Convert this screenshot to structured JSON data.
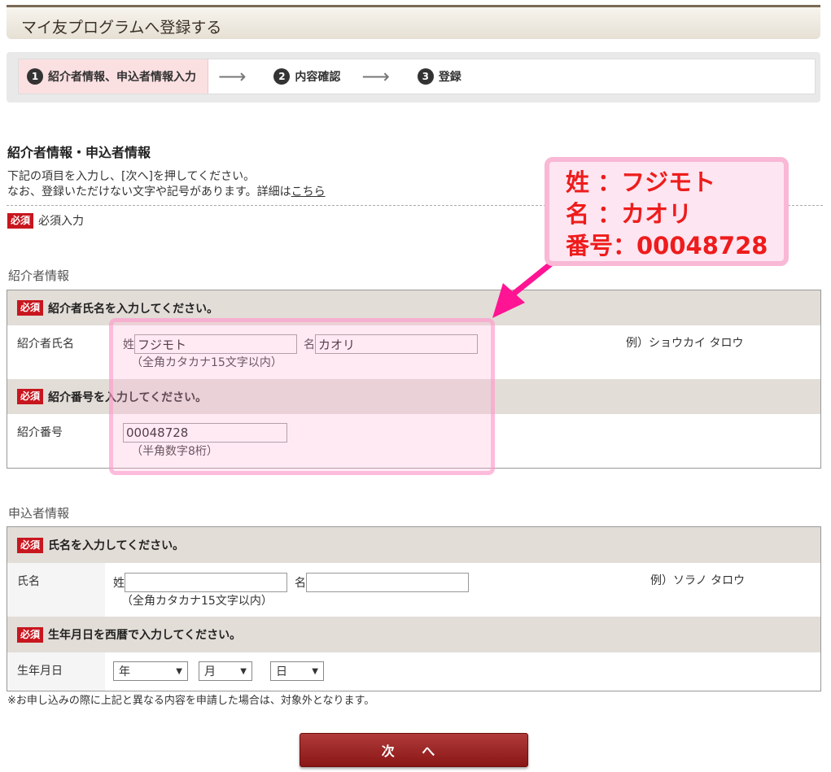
{
  "page": {
    "title": "マイ友プログラムへ登録する"
  },
  "steps": [
    {
      "num": "1",
      "label": "紹介者情報、申込者情報入力",
      "active": true
    },
    {
      "num": "2",
      "label": "内容確認",
      "active": false
    },
    {
      "num": "3",
      "label": "登録",
      "active": false
    }
  ],
  "step_arrow": "⟶",
  "section": {
    "title": "紹介者情報・申込者情報",
    "desc_line1": "下記の項目を入力し、[次へ]を押してください。",
    "desc_line2_prefix": "なお、登録いただけない文字や記号があります。詳細は",
    "desc_link": "こちら",
    "required_badge": "必須",
    "required_legend": "必須入力"
  },
  "referrer": {
    "heading": "紹介者情報",
    "name_head": "紹介者氏名を入力してください。",
    "name_label": "紹介者氏名",
    "last_prefix": "姓",
    "last_value": "フジモト",
    "first_prefix": "名",
    "first_value": "カオリ",
    "name_hint": "（全角カタカナ15文字以内）",
    "name_example": "例）ショウカイ タロウ",
    "number_head": "紹介番号を入力してください。",
    "number_label": "紹介番号",
    "number_value": "00048728",
    "number_hint": "（半角数字8桁）"
  },
  "applicant": {
    "heading": "申込者情報",
    "name_head": "氏名を入力してください。",
    "name_label": "氏名",
    "last_prefix": "姓",
    "last_value": "",
    "first_prefix": "名",
    "first_value": "",
    "name_hint": "（全角カタカナ15文字以内）",
    "name_example": "例）ソラノ タロウ",
    "birth_head": "生年月日を西暦で入力してください。",
    "birth_label": "生年月日",
    "year": "年",
    "month": "月",
    "day": "日"
  },
  "note": "※お申し込みの際に上記と異なる内容を申請した場合は、対象外となります。",
  "next_button": "次 へ",
  "callout": {
    "line1": "姓 ：フジモト",
    "line2": "名 ：カオリ",
    "line3": "番号：00048728"
  },
  "colors": {
    "required": "#c8161e",
    "callout_text": "#ee1c1c",
    "callout_border": "#f9b8d6",
    "arrow": "#ff1493",
    "button": "#8a1616"
  }
}
